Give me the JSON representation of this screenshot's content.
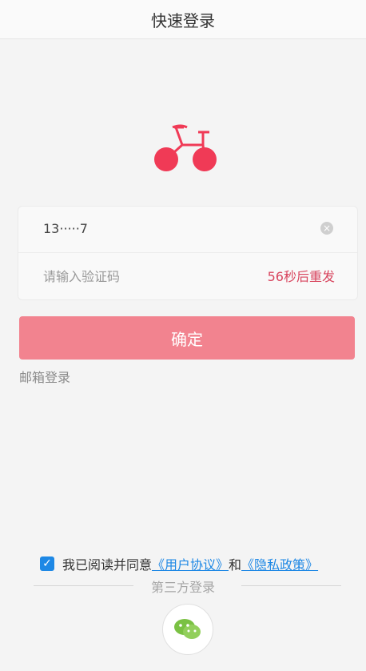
{
  "header": {
    "title": "快速登录"
  },
  "form": {
    "phone_value": "13·····7",
    "code_placeholder": "请输入验证码",
    "resend_label": "56秒后重发",
    "clear_icon": "close-circle-icon"
  },
  "actions": {
    "confirm_label": "确定",
    "email_login_label": "邮箱登录"
  },
  "agreement": {
    "prefix": "我已阅读并同意",
    "user_agreement": "《用户协议》",
    "and": "和",
    "privacy_policy": "《隐私政策》",
    "checked": true
  },
  "third_party": {
    "label": "第三方登录",
    "icon": "wechat-icon"
  },
  "colors": {
    "accent": "#f2838f",
    "logo": "#f03a56",
    "link": "#1e88e5",
    "resend": "#d8455e"
  }
}
